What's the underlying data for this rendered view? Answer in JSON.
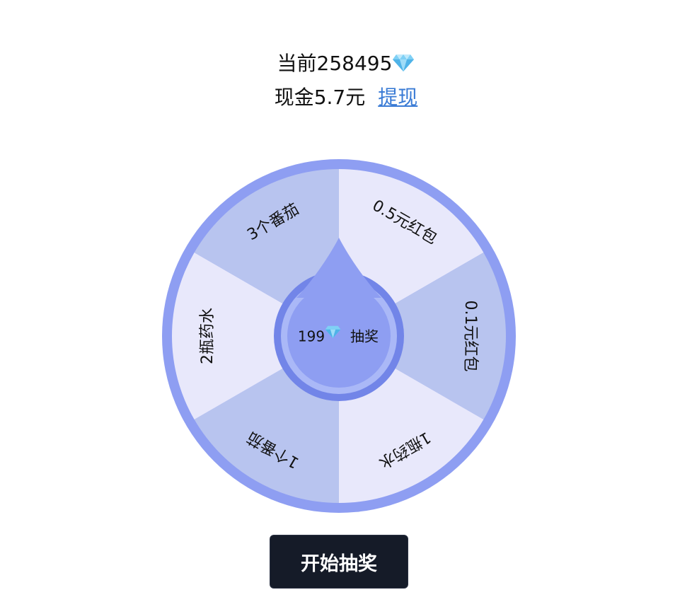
{
  "balance": {
    "current_label": "当前258495",
    "cash_label": "现金5.7元",
    "withdraw_label": "提现"
  },
  "wheel": {
    "segments": [
      {
        "label": "0.5元红包",
        "color": "#e8e8fb"
      },
      {
        "label": "0.1元红包",
        "color": "#b8c4ef"
      },
      {
        "label": "1瓶药水",
        "color": "#e8e8fb"
      },
      {
        "label": "1个番茄",
        "color": "#b8c4ef"
      },
      {
        "label": "2瓶药水",
        "color": "#e8e8fb"
      },
      {
        "label": "3个番茄",
        "color": "#b8c4ef"
      }
    ],
    "center": {
      "cost": "199",
      "action_label": "抽奖"
    },
    "colors": {
      "rim": "#8e9ef2",
      "hub_ring": "#7285e8",
      "hub_inner_ring": "#aab8f7",
      "hub_fill": "#8e9ef2"
    }
  },
  "start_button": {
    "label": "开始抽奖"
  },
  "icons": {
    "diamond": "diamond-icon"
  }
}
